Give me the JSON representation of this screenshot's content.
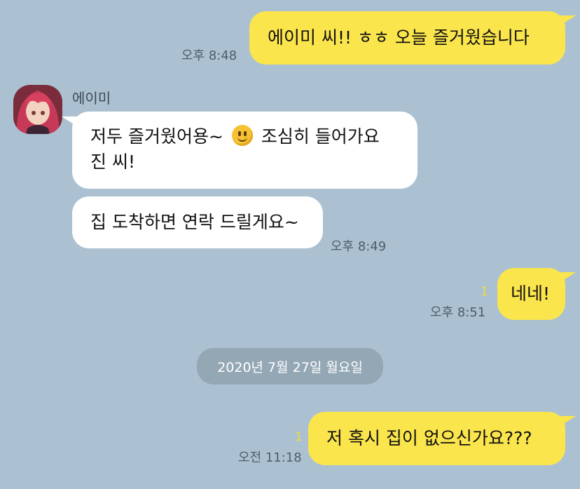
{
  "messages": [
    {
      "text": "에이미 씨!! ㅎㅎ 오늘 즐거웠습니다",
      "time": "오후 8:48"
    },
    {
      "sender": "에이미",
      "text_a": "저두 즐거웠어용~",
      "emoji": "slightly-smiling-face-emoji",
      "text_b": "조심히 들어가요 진 씨!"
    },
    {
      "text": "집 도착하면 연락 드릴게요~",
      "time": "오후 8:49"
    },
    {
      "text": "네네!",
      "time": "오후 8:51",
      "unread": "1"
    },
    {
      "text": "저 혹시 집이 없으신가요???",
      "time": "오전 11:18",
      "unread": "1"
    }
  ],
  "date_separator": "2020년 7월 27일 월요일",
  "colors": {
    "background": "#abc1d1",
    "my_bubble": "#fbe54c",
    "other_bubble": "#ffffff",
    "unread": "#f4dc39"
  }
}
